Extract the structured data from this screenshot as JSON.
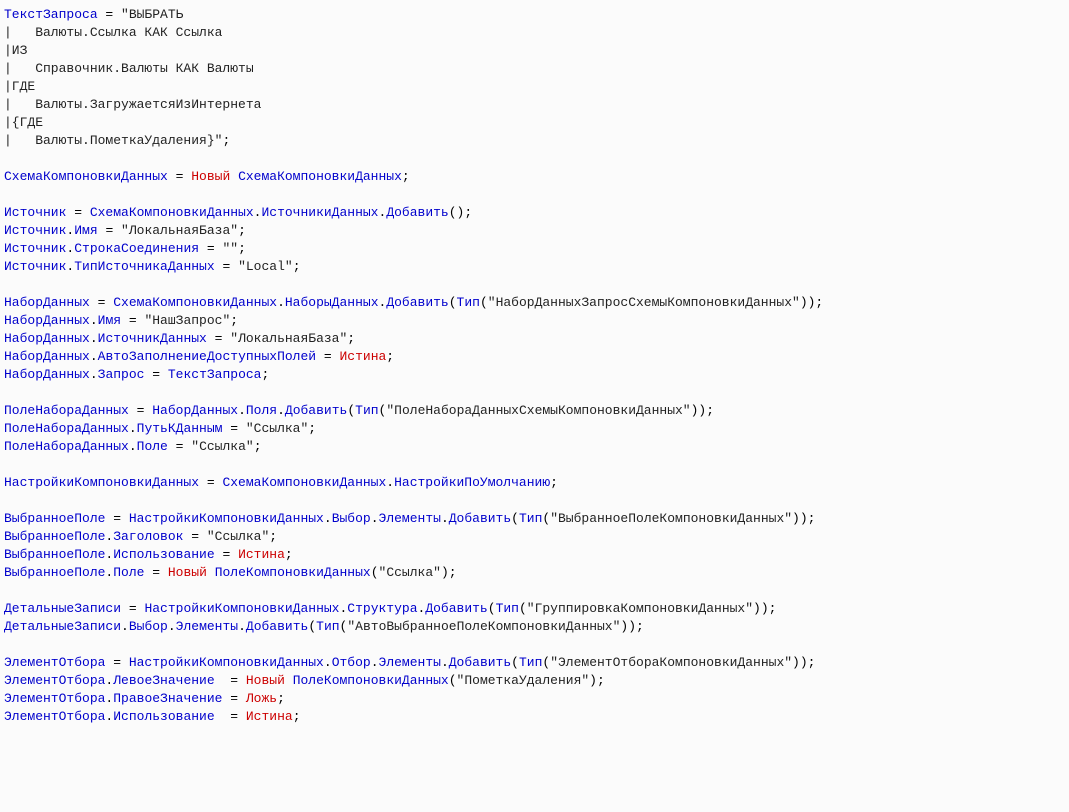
{
  "code": {
    "tokens": [
      {
        "c": "v",
        "t": "ТекстЗапроса"
      },
      {
        "c": "p",
        "t": " = "
      },
      {
        "c": "s",
        "t": "\"ВЫБРАТЬ"
      },
      {
        "c": "p",
        "t": "\n"
      },
      {
        "c": "s",
        "t": "|   Валюты.Ссылка КАК Ссылка"
      },
      {
        "c": "p",
        "t": "\n"
      },
      {
        "c": "s",
        "t": "|ИЗ"
      },
      {
        "c": "p",
        "t": "\n"
      },
      {
        "c": "s",
        "t": "|   Справочник.Валюты КАК Валюты"
      },
      {
        "c": "p",
        "t": "\n"
      },
      {
        "c": "s",
        "t": "|ГДЕ"
      },
      {
        "c": "p",
        "t": "\n"
      },
      {
        "c": "s",
        "t": "|   Валюты.ЗагружаетсяИзИнтернета"
      },
      {
        "c": "p",
        "t": "\n"
      },
      {
        "c": "s",
        "t": "|{ГДЕ"
      },
      {
        "c": "p",
        "t": "\n"
      },
      {
        "c": "s",
        "t": "|   Валюты.ПометкаУдаления}\""
      },
      {
        "c": "p",
        "t": ";\n"
      },
      {
        "c": "p",
        "t": "\n"
      },
      {
        "c": "v",
        "t": "СхемаКомпоновкиДанных"
      },
      {
        "c": "p",
        "t": " = "
      },
      {
        "c": "k",
        "t": "Новый"
      },
      {
        "c": "p",
        "t": " "
      },
      {
        "c": "v",
        "t": "СхемаКомпоновкиДанных"
      },
      {
        "c": "p",
        "t": ";\n"
      },
      {
        "c": "p",
        "t": "\n"
      },
      {
        "c": "v",
        "t": "Источник"
      },
      {
        "c": "p",
        "t": " = "
      },
      {
        "c": "v",
        "t": "СхемаКомпоновкиДанных"
      },
      {
        "c": "p",
        "t": "."
      },
      {
        "c": "v",
        "t": "ИсточникиДанных"
      },
      {
        "c": "p",
        "t": "."
      },
      {
        "c": "v",
        "t": "Добавить"
      },
      {
        "c": "p",
        "t": "();\n"
      },
      {
        "c": "v",
        "t": "Источник"
      },
      {
        "c": "p",
        "t": "."
      },
      {
        "c": "v",
        "t": "Имя"
      },
      {
        "c": "p",
        "t": " = "
      },
      {
        "c": "s",
        "t": "\"ЛокальнаяБаза\""
      },
      {
        "c": "p",
        "t": ";\n"
      },
      {
        "c": "v",
        "t": "Источник"
      },
      {
        "c": "p",
        "t": "."
      },
      {
        "c": "v",
        "t": "СтрокаСоединения"
      },
      {
        "c": "p",
        "t": " = "
      },
      {
        "c": "s",
        "t": "\"\""
      },
      {
        "c": "p",
        "t": ";\n"
      },
      {
        "c": "v",
        "t": "Источник"
      },
      {
        "c": "p",
        "t": "."
      },
      {
        "c": "v",
        "t": "ТипИсточникаДанных"
      },
      {
        "c": "p",
        "t": " = "
      },
      {
        "c": "s",
        "t": "\"Local\""
      },
      {
        "c": "p",
        "t": ";\n"
      },
      {
        "c": "p",
        "t": "\n"
      },
      {
        "c": "v",
        "t": "НаборДанных"
      },
      {
        "c": "p",
        "t": " = "
      },
      {
        "c": "v",
        "t": "СхемаКомпоновкиДанных"
      },
      {
        "c": "p",
        "t": "."
      },
      {
        "c": "v",
        "t": "НаборыДанных"
      },
      {
        "c": "p",
        "t": "."
      },
      {
        "c": "v",
        "t": "Добавить"
      },
      {
        "c": "p",
        "t": "("
      },
      {
        "c": "v",
        "t": "Тип"
      },
      {
        "c": "p",
        "t": "("
      },
      {
        "c": "s",
        "t": "\"НаборДанныхЗапросСхемыКомпоновкиДанных\""
      },
      {
        "c": "p",
        "t": "));\n"
      },
      {
        "c": "v",
        "t": "НаборДанных"
      },
      {
        "c": "p",
        "t": "."
      },
      {
        "c": "v",
        "t": "Имя"
      },
      {
        "c": "p",
        "t": " = "
      },
      {
        "c": "s",
        "t": "\"НашЗапрос\""
      },
      {
        "c": "p",
        "t": ";\n"
      },
      {
        "c": "v",
        "t": "НаборДанных"
      },
      {
        "c": "p",
        "t": "."
      },
      {
        "c": "v",
        "t": "ИсточникДанных"
      },
      {
        "c": "p",
        "t": " = "
      },
      {
        "c": "s",
        "t": "\"ЛокальнаяБаза\""
      },
      {
        "c": "p",
        "t": ";\n"
      },
      {
        "c": "v",
        "t": "НаборДанных"
      },
      {
        "c": "p",
        "t": "."
      },
      {
        "c": "v",
        "t": "АвтоЗаполнениеДоступныхПолей"
      },
      {
        "c": "p",
        "t": " = "
      },
      {
        "c": "k",
        "t": "Истина"
      },
      {
        "c": "p",
        "t": ";\n"
      },
      {
        "c": "v",
        "t": "НаборДанных"
      },
      {
        "c": "p",
        "t": "."
      },
      {
        "c": "v",
        "t": "Запрос"
      },
      {
        "c": "p",
        "t": " = "
      },
      {
        "c": "v",
        "t": "ТекстЗапроса"
      },
      {
        "c": "p",
        "t": ";\n"
      },
      {
        "c": "p",
        "t": "\n"
      },
      {
        "c": "v",
        "t": "ПолеНабораДанных"
      },
      {
        "c": "p",
        "t": " = "
      },
      {
        "c": "v",
        "t": "НаборДанных"
      },
      {
        "c": "p",
        "t": "."
      },
      {
        "c": "v",
        "t": "Поля"
      },
      {
        "c": "p",
        "t": "."
      },
      {
        "c": "v",
        "t": "Добавить"
      },
      {
        "c": "p",
        "t": "("
      },
      {
        "c": "v",
        "t": "Тип"
      },
      {
        "c": "p",
        "t": "("
      },
      {
        "c": "s",
        "t": "\"ПолеНабораДанныхСхемыКомпоновкиДанных\""
      },
      {
        "c": "p",
        "t": "));\n"
      },
      {
        "c": "v",
        "t": "ПолеНабораДанных"
      },
      {
        "c": "p",
        "t": "."
      },
      {
        "c": "v",
        "t": "ПутьКДанным"
      },
      {
        "c": "p",
        "t": " = "
      },
      {
        "c": "s",
        "t": "\"Ссылка\""
      },
      {
        "c": "p",
        "t": ";\n"
      },
      {
        "c": "v",
        "t": "ПолеНабораДанных"
      },
      {
        "c": "p",
        "t": "."
      },
      {
        "c": "v",
        "t": "Поле"
      },
      {
        "c": "p",
        "t": " = "
      },
      {
        "c": "s",
        "t": "\"Ссылка\""
      },
      {
        "c": "p",
        "t": ";\n"
      },
      {
        "c": "p",
        "t": "\n"
      },
      {
        "c": "v",
        "t": "НастройкиКомпоновкиДанных"
      },
      {
        "c": "p",
        "t": " = "
      },
      {
        "c": "v",
        "t": "СхемаКомпоновкиДанных"
      },
      {
        "c": "p",
        "t": "."
      },
      {
        "c": "v",
        "t": "НастройкиПоУмолчанию"
      },
      {
        "c": "p",
        "t": ";\n"
      },
      {
        "c": "p",
        "t": "\n"
      },
      {
        "c": "v",
        "t": "ВыбранноеПоле"
      },
      {
        "c": "p",
        "t": " = "
      },
      {
        "c": "v",
        "t": "НастройкиКомпоновкиДанных"
      },
      {
        "c": "p",
        "t": "."
      },
      {
        "c": "v",
        "t": "Выбор"
      },
      {
        "c": "p",
        "t": "."
      },
      {
        "c": "v",
        "t": "Элементы"
      },
      {
        "c": "p",
        "t": "."
      },
      {
        "c": "v",
        "t": "Добавить"
      },
      {
        "c": "p",
        "t": "("
      },
      {
        "c": "v",
        "t": "Тип"
      },
      {
        "c": "p",
        "t": "("
      },
      {
        "c": "s",
        "t": "\"ВыбранноеПолеКомпоновкиДанных\""
      },
      {
        "c": "p",
        "t": "));\n"
      },
      {
        "c": "v",
        "t": "ВыбранноеПоле"
      },
      {
        "c": "p",
        "t": "."
      },
      {
        "c": "v",
        "t": "Заголовок"
      },
      {
        "c": "p",
        "t": " = "
      },
      {
        "c": "s",
        "t": "\"Ссылка\""
      },
      {
        "c": "p",
        "t": ";\n"
      },
      {
        "c": "v",
        "t": "ВыбранноеПоле"
      },
      {
        "c": "p",
        "t": "."
      },
      {
        "c": "v",
        "t": "Использование"
      },
      {
        "c": "p",
        "t": " = "
      },
      {
        "c": "k",
        "t": "Истина"
      },
      {
        "c": "p",
        "t": ";\n"
      },
      {
        "c": "v",
        "t": "ВыбранноеПоле"
      },
      {
        "c": "p",
        "t": "."
      },
      {
        "c": "v",
        "t": "Поле"
      },
      {
        "c": "p",
        "t": " = "
      },
      {
        "c": "k",
        "t": "Новый"
      },
      {
        "c": "p",
        "t": " "
      },
      {
        "c": "v",
        "t": "ПолеКомпоновкиДанных"
      },
      {
        "c": "p",
        "t": "("
      },
      {
        "c": "s",
        "t": "\"Ссылка\""
      },
      {
        "c": "p",
        "t": ");\n"
      },
      {
        "c": "p",
        "t": "\n"
      },
      {
        "c": "v",
        "t": "ДетальныеЗаписи"
      },
      {
        "c": "p",
        "t": " = "
      },
      {
        "c": "v",
        "t": "НастройкиКомпоновкиДанных"
      },
      {
        "c": "p",
        "t": "."
      },
      {
        "c": "v",
        "t": "Структура"
      },
      {
        "c": "p",
        "t": "."
      },
      {
        "c": "v",
        "t": "Добавить"
      },
      {
        "c": "p",
        "t": "("
      },
      {
        "c": "v",
        "t": "Тип"
      },
      {
        "c": "p",
        "t": "("
      },
      {
        "c": "s",
        "t": "\"ГруппировкаКомпоновкиДанных\""
      },
      {
        "c": "p",
        "t": "));\n"
      },
      {
        "c": "v",
        "t": "ДетальныеЗаписи"
      },
      {
        "c": "p",
        "t": "."
      },
      {
        "c": "v",
        "t": "Выбор"
      },
      {
        "c": "p",
        "t": "."
      },
      {
        "c": "v",
        "t": "Элементы"
      },
      {
        "c": "p",
        "t": "."
      },
      {
        "c": "v",
        "t": "Добавить"
      },
      {
        "c": "p",
        "t": "("
      },
      {
        "c": "v",
        "t": "Тип"
      },
      {
        "c": "p",
        "t": "("
      },
      {
        "c": "s",
        "t": "\"АвтоВыбранноеПолеКомпоновкиДанных\""
      },
      {
        "c": "p",
        "t": "));\n"
      },
      {
        "c": "p",
        "t": "\n"
      },
      {
        "c": "v",
        "t": "ЭлементОтбора"
      },
      {
        "c": "p",
        "t": " = "
      },
      {
        "c": "v",
        "t": "НастройкиКомпоновкиДанных"
      },
      {
        "c": "p",
        "t": "."
      },
      {
        "c": "v",
        "t": "Отбор"
      },
      {
        "c": "p",
        "t": "."
      },
      {
        "c": "v",
        "t": "Элементы"
      },
      {
        "c": "p",
        "t": "."
      },
      {
        "c": "v",
        "t": "Добавить"
      },
      {
        "c": "p",
        "t": "("
      },
      {
        "c": "v",
        "t": "Тип"
      },
      {
        "c": "p",
        "t": "("
      },
      {
        "c": "s",
        "t": "\"ЭлементОтбораКомпоновкиДанных\""
      },
      {
        "c": "p",
        "t": "));\n"
      },
      {
        "c": "v",
        "t": "ЭлементОтбора"
      },
      {
        "c": "p",
        "t": "."
      },
      {
        "c": "v",
        "t": "ЛевоеЗначение"
      },
      {
        "c": "p",
        "t": "  = "
      },
      {
        "c": "k",
        "t": "Новый"
      },
      {
        "c": "p",
        "t": " "
      },
      {
        "c": "v",
        "t": "ПолеКомпоновкиДанных"
      },
      {
        "c": "p",
        "t": "("
      },
      {
        "c": "s",
        "t": "\"ПометкаУдаления\""
      },
      {
        "c": "p",
        "t": ");\n"
      },
      {
        "c": "v",
        "t": "ЭлементОтбора"
      },
      {
        "c": "p",
        "t": "."
      },
      {
        "c": "v",
        "t": "ПравоеЗначение"
      },
      {
        "c": "p",
        "t": " = "
      },
      {
        "c": "k",
        "t": "Ложь"
      },
      {
        "c": "p",
        "t": ";\n"
      },
      {
        "c": "v",
        "t": "ЭлементОтбора"
      },
      {
        "c": "p",
        "t": "."
      },
      {
        "c": "v",
        "t": "Использование"
      },
      {
        "c": "p",
        "t": "  = "
      },
      {
        "c": "k",
        "t": "Истина"
      },
      {
        "c": "p",
        "t": ";\n"
      }
    ]
  }
}
